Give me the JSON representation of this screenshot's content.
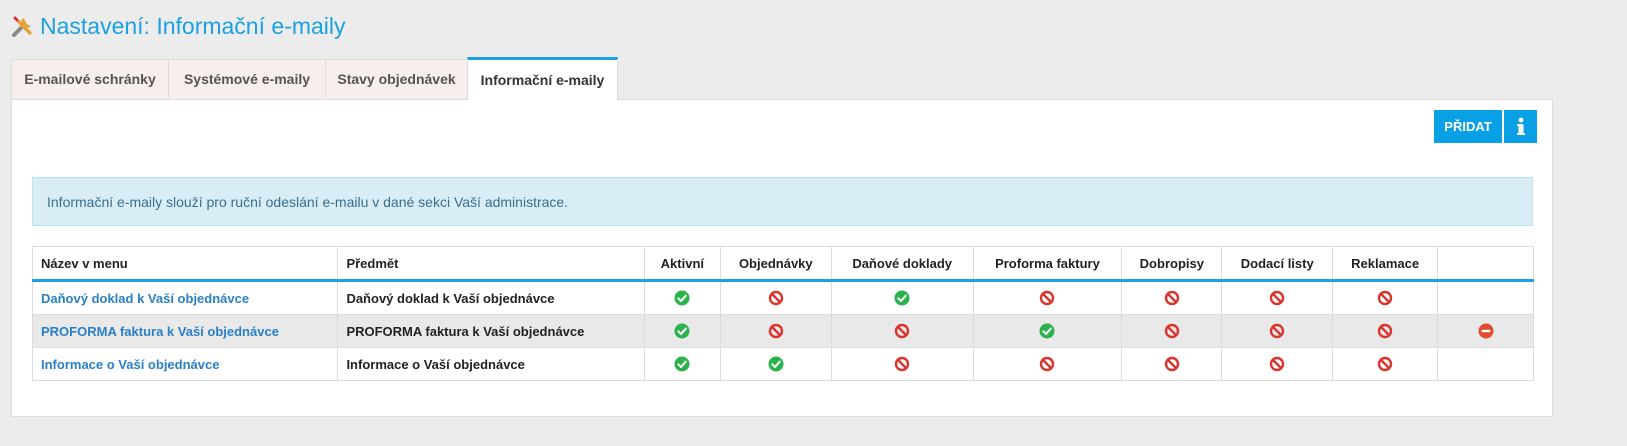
{
  "header": {
    "title": "Nastavení: Informační e-maily",
    "icon": "tools-icon"
  },
  "tabs": [
    {
      "label": "E-mailové schránky",
      "active": false
    },
    {
      "label": "Systémové e-maily",
      "active": false
    },
    {
      "label": "Stavy objednávek",
      "active": false
    },
    {
      "label": "Informační e-maily",
      "active": true
    }
  ],
  "toolbar": {
    "add_label": "PŘIDAT",
    "info_icon": "info-icon"
  },
  "alert": {
    "text": "Informační e-maily slouží pro ruční odeslání e-mailu v dané sekci Vaší administrace."
  },
  "table": {
    "headers": [
      "Název v menu",
      "Předmět",
      "Aktivní",
      "Objednávky",
      "Daňové doklady",
      "Proforma faktury",
      "Dobropisy",
      "Dodací listy",
      "Reklamace",
      ""
    ],
    "rows": [
      {
        "name": "Daňový doklad k Vaší objednávce",
        "subject": "Daňový doklad k Vaší objednávce",
        "flags": [
          "yes",
          "no",
          "yes",
          "no",
          "no",
          "no",
          "no"
        ],
        "delete": false
      },
      {
        "name": "PROFORMA faktura k Vaší objednávce",
        "subject": "PROFORMA faktura k Vaší objednávce",
        "flags": [
          "yes",
          "no",
          "no",
          "yes",
          "no",
          "no",
          "no"
        ],
        "delete": true
      },
      {
        "name": "Informace o Vaší objednávce",
        "subject": "Informace o Vaší objednávce",
        "flags": [
          "yes",
          "yes",
          "no",
          "no",
          "no",
          "no",
          "no"
        ],
        "delete": false
      }
    ]
  },
  "colors": {
    "accent": "#1ba1e2",
    "button": "#0aa0e6",
    "yes": "#2bb24c",
    "no": "#d9352c",
    "delete": "#e04a2f"
  }
}
